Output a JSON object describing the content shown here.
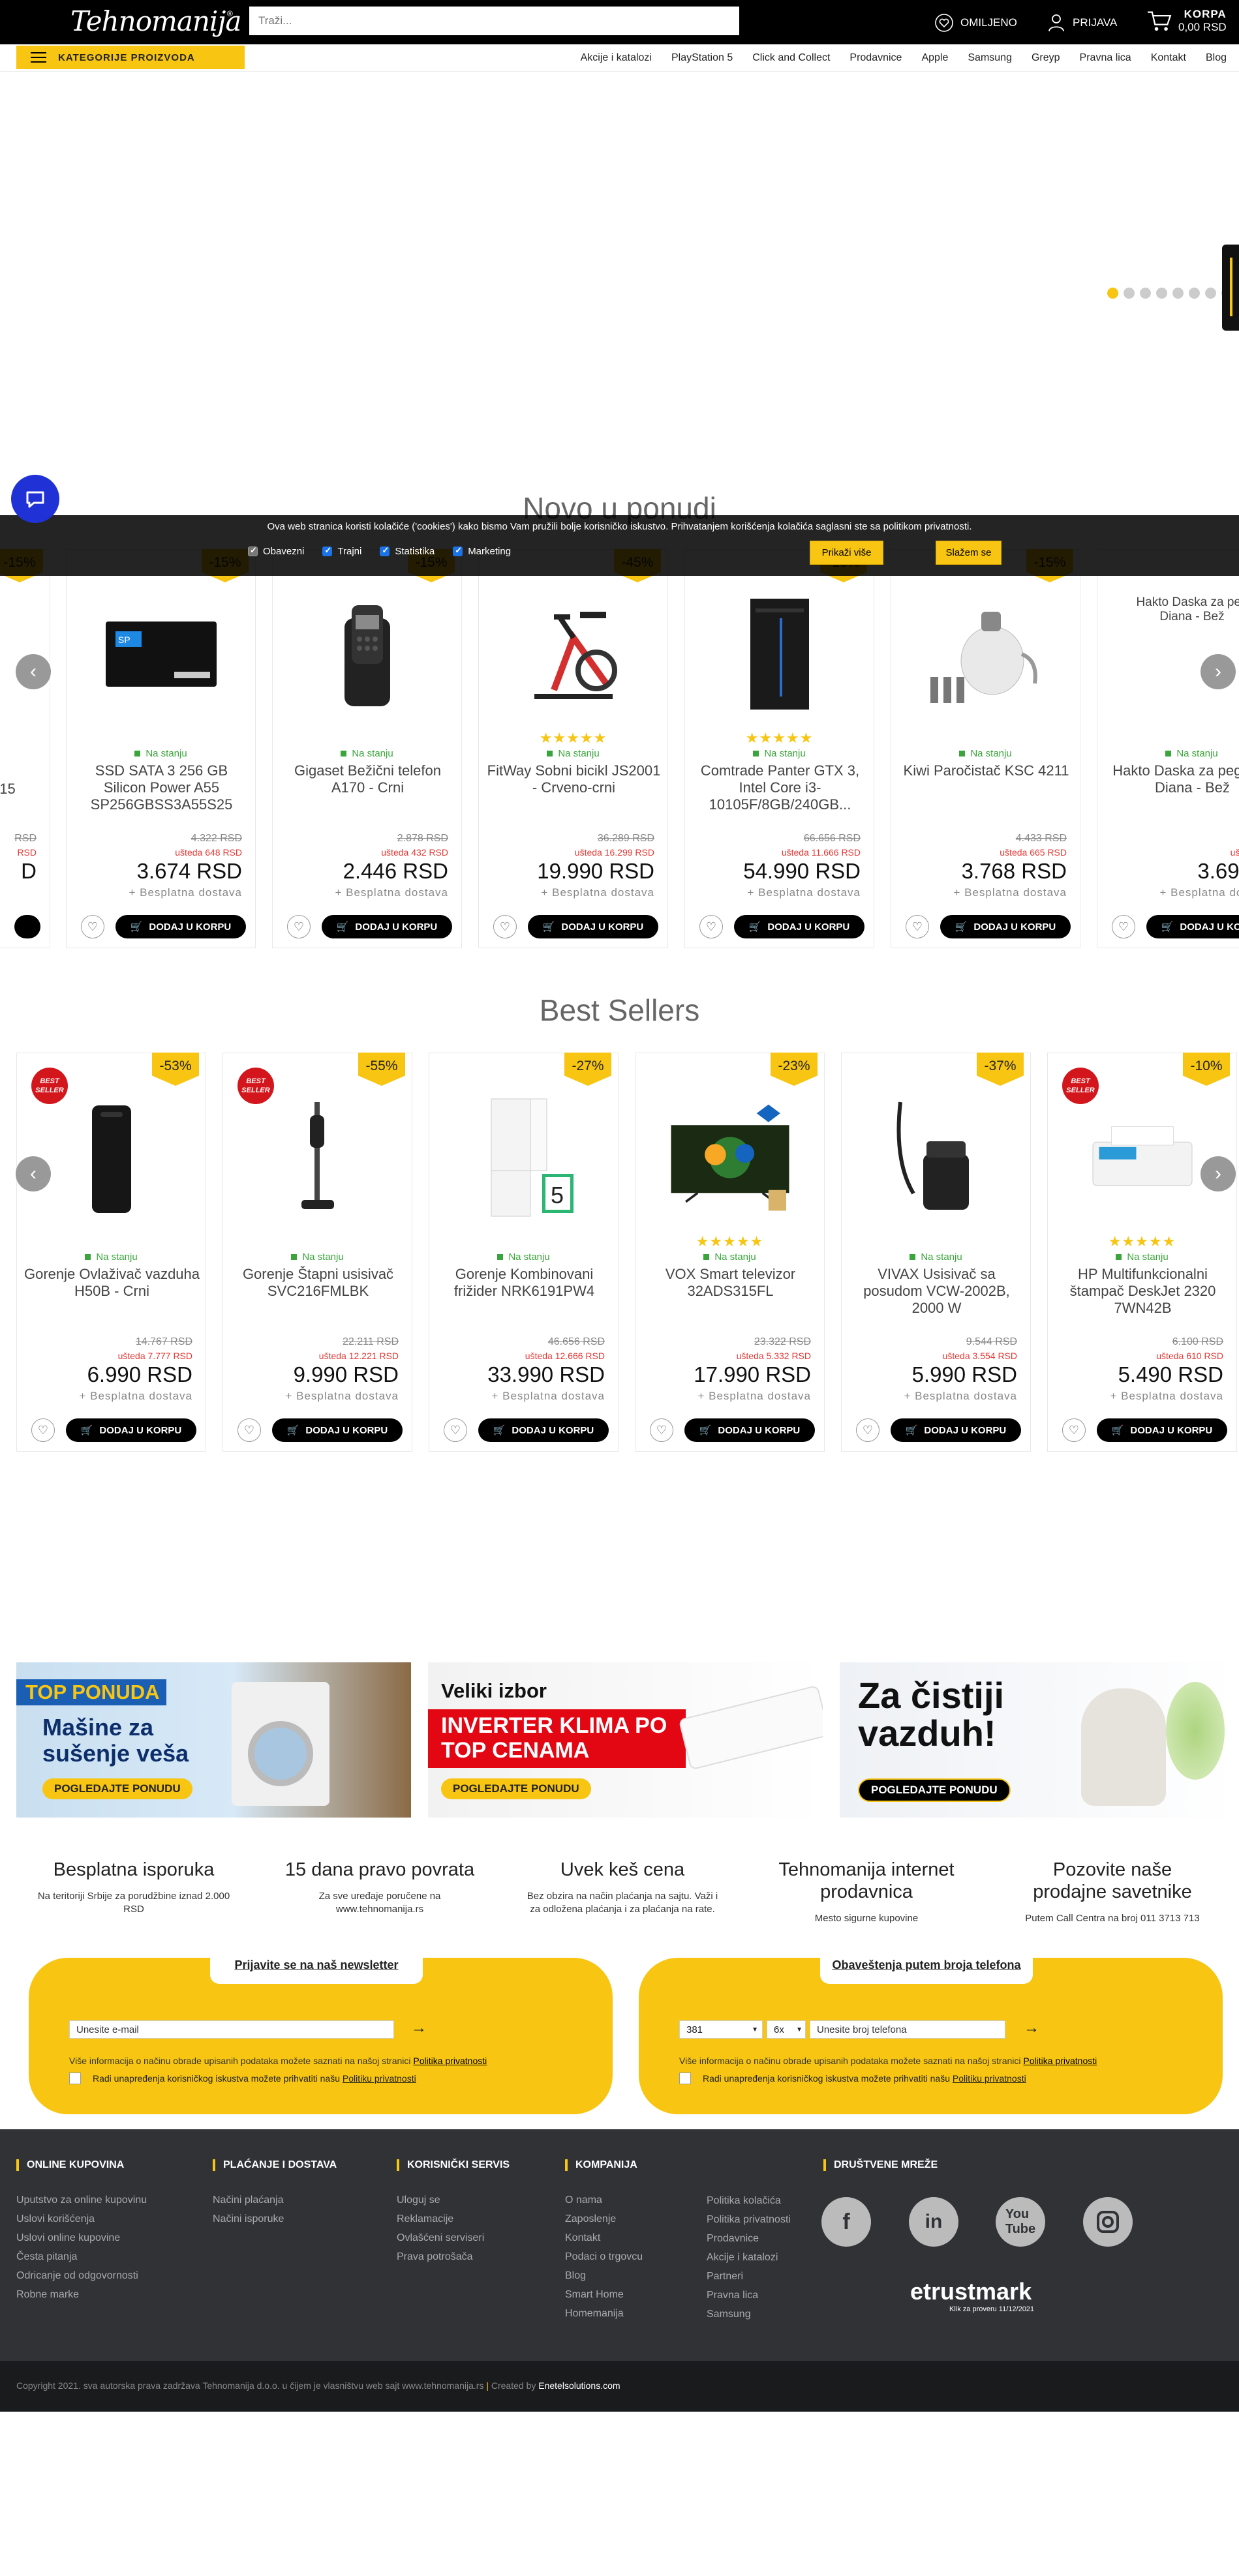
{
  "header": {
    "logo": "Tehnomanija",
    "logo_reg": "®",
    "search_placeholder": "Traži...",
    "favorites": "OMILJENO",
    "login": "PRIJAVA",
    "cart_label": "KORPA",
    "cart_total": "0,00 RSD"
  },
  "nav": {
    "categories": "KATEGORIJE PROIZVODA",
    "links": [
      "Akcije i katalozi",
      "PlayStation 5",
      "Click and Collect",
      "Prodavnice",
      "Apple",
      "Samsung",
      "Greyp",
      "Pravna lica",
      "Kontakt",
      "Blog"
    ]
  },
  "hero": {
    "dots": 8,
    "active_dot": 0
  },
  "cookie": {
    "text": "Ova web stranica koristi kolačiće ('cookies') kako bismo Vam pružili bolje korisničko iskustvo. Prihvatanjem korišćenja kolačića saglasni ste sa politikom privatnosti.",
    "options": [
      "Obavezni",
      "Trajni",
      "Statistika",
      "Marketing"
    ],
    "more": "Prikaži više",
    "agree": "Slažem se"
  },
  "new_section": {
    "title": "Novo u ponudi",
    "partial_left": {
      "name": "215",
      "price": "D",
      "old": "RSD",
      "save": "RSD"
    },
    "products": [
      {
        "name": "SSD SATA 3 256 GB Silicon Power A55 SP256GBSS3A55S25",
        "discount": "-15%",
        "stock": "Na stanju",
        "stars": false,
        "old": "4.322 RSD",
        "save": "ušteda 648 RSD",
        "price": "3.674 RSD",
        "ship": "+ Besplatna dostava",
        "img": "ssd"
      },
      {
        "name": "Gigaset Bežični telefon A170 - Crni",
        "discount": "-15%",
        "stock": "Na stanju",
        "stars": false,
        "old": "2.878 RSD",
        "save": "ušteda 432 RSD",
        "price": "2.446 RSD",
        "ship": "+ Besplatna dostava",
        "img": "phone"
      },
      {
        "name": "FitWay Sobni bicikl JS2001 - Crveno-crni",
        "discount": "-45%",
        "stock": "Na stanju",
        "stars": true,
        "old": "36.289 RSD",
        "save": "ušteda 16.299 RSD",
        "price": "19.990 RSD",
        "ship": "+ Besplatna dostava",
        "img": "bike"
      },
      {
        "name": "Comtrade Panter GTX 3, Intel Core i3-10105F/8GB/240GB...",
        "discount": "-18%",
        "stock": "Na stanju",
        "stars": true,
        "old": "66.656 RSD",
        "save": "ušteda 11.666 RSD",
        "price": "54.990 RSD",
        "ship": "+ Besplatna dostava",
        "img": "pc"
      },
      {
        "name": "Kiwi Paročistač KSC 4211",
        "discount": "-15%",
        "stock": "Na stanju",
        "stars": false,
        "old": "4.433 RSD",
        "save": "ušteda 665 RSD",
        "price": "3.768 RSD",
        "ship": "+ Besplatna dostava",
        "img": "steam"
      },
      {
        "name": "Hakto Daska za peglanje Diana - Bež",
        "discount": "",
        "stock": "Na stanju",
        "stars": false,
        "old": "5.54",
        "save": "ušteda 1.8",
        "price": "3.690 R",
        "ship": "+ Besplatna dostava",
        "img": "broken",
        "alt": "Hakto Daska za peg Diana - Bež"
      }
    ]
  },
  "best_section": {
    "title": "Best Sellers",
    "best_label": "BEST SELLER",
    "products": [
      {
        "name": "Gorenje Ovlaživač vazduha H50B - Crni",
        "discount": "-53%",
        "best": true,
        "stars": false,
        "stock": "Na stanju",
        "old": "14.767 RSD",
        "save": "ušteda 7.777 RSD",
        "price": "6.990 RSD",
        "ship": "+ Besplatna dostava",
        "img": "humid"
      },
      {
        "name": "Gorenje Štapni usisivač SVC216FMLBK",
        "discount": "-55%",
        "best": true,
        "stars": false,
        "stock": "Na stanju",
        "old": "22.211 RSD",
        "save": "ušteda 12.221 RSD",
        "price": "9.990 RSD",
        "ship": "+ Besplatna dostava",
        "img": "stick"
      },
      {
        "name": "Gorenje Kombinovani frižider NRK6191PW4",
        "discount": "-27%",
        "best": false,
        "stars": false,
        "stock": "Na stanju",
        "old": "46.656 RSD",
        "save": "ušteda 12.666 RSD",
        "price": "33.990 RSD",
        "ship": "+ Besplatna dostava",
        "img": "fridge",
        "warranty": "5"
      },
      {
        "name": "VOX Smart televizor 32ADS315FL",
        "discount": "-23%",
        "best": false,
        "stars": true,
        "stock": "Na stanju",
        "old": "23.322 RSD",
        "save": "ušteda 5.332 RSD",
        "price": "17.990 RSD",
        "ship": "+ Besplatna dostava",
        "img": "tv"
      },
      {
        "name": "VIVAX Usisivač sa posudom VCW-2002B, 2000 W",
        "discount": "-37%",
        "best": false,
        "stars": false,
        "stock": "Na stanju",
        "old": "9.544 RSD",
        "save": "ušteda 3.554 RSD",
        "price": "5.990 RSD",
        "ship": "+ Besplatna dostava",
        "img": "vacuum"
      },
      {
        "name": "HP Multifunkcionalni štampač DeskJet 2320 7WN42B",
        "discount": "-10%",
        "best": true,
        "stars": true,
        "stock": "Na stanju",
        "old": "6.100 RSD",
        "save": "ušteda 610 RSD",
        "price": "5.490 RSD",
        "ship": "+ Besplatna dostava",
        "img": "printer"
      }
    ],
    "add_label": "DODAJ U KORPU"
  },
  "banners": [
    {
      "tag": "TOP PONUDA",
      "title": "Mašine za sušenje veša",
      "cta": "POGLEDAJTE PONUDU"
    },
    {
      "tag": "Veliki izbor",
      "title": "INVERTER KLIMA PO TOP CENAMA",
      "cta": "POGLEDAJTE PONUDU"
    },
    {
      "tag": "",
      "title": "Za čistiji vazduh!",
      "cta": "POGLEDAJTE PONUDU"
    }
  ],
  "features": [
    {
      "title": "Besplatna isporuka",
      "text": "Na teritoriji Srbije za porudžbine iznad 2.000 RSD"
    },
    {
      "title": "15 dana pravo povrata",
      "text": "Za sve uređaje poručene na www.tehnomanija.rs"
    },
    {
      "title": "Uvek keš cena",
      "text": "Bez obzira na način plaćanja na sajtu. Važi i za odložena plaćanja i za plaćanja na rate."
    },
    {
      "title": "Tehnomanija internet prodavnica",
      "text": "Mesto sigurne kupovine"
    },
    {
      "title": "Pozovite naše prodajne savetnike",
      "text": "Putem Call Centra na broj 011 3713 713"
    }
  ],
  "newsletter": {
    "email_title": "Prijavite se na naš newsletter",
    "email_placeholder": "Unesite e-mail",
    "phone_title": "Obaveštenja putem broja telefona",
    "prefix": "381",
    "operator": "6x",
    "phone_placeholder": "Unesite broj telefona",
    "note": "Više informacija o načinu obrade upisanih podataka možete saznati na našoj stranici",
    "note_link": "Politika privatnosti",
    "consent": "Radi unapređenja korisničkog iskustva možete prihvatiti našu",
    "consent_link": "Politiku privatnosti"
  },
  "footer": {
    "cols": [
      {
        "title": "ONLINE KUPOVINA",
        "items": [
          "Uputstvo za online kupovinu",
          "Uslovi korišćenja",
          "Uslovi online kupovine",
          "Česta pitanja",
          "Odricanje od odgovornosti",
          "Robne marke"
        ]
      },
      {
        "title": "PLAĆANJE I DOSTAVA",
        "items": [
          "Načini plaćanja",
          "Načini isporuke"
        ]
      },
      {
        "title": "KORISNIČKI SERVIS",
        "items": [
          "Uloguj se",
          "Reklamacije",
          "Ovlašćeni serviseri",
          "Prava potrošača"
        ]
      },
      {
        "title": "KOMPANIJA",
        "items": [
          "O nama",
          "Zaposlenje",
          "Kontakt",
          "Podaci o trgovcu",
          "Blog",
          "Smart Home",
          "Homemanija"
        ]
      },
      {
        "title": "",
        "items": [
          "Politika kolačića",
          "Politika privatnosti",
          "Prodavnice",
          "Akcije i katalozi",
          "Partneri",
          "Pravna lica",
          "Samsung"
        ]
      }
    ],
    "social_title": "DRUŠTVENE MREŽE",
    "trustmark": "trustmark",
    "trust_note": "Klik za proveru 11/12/2021",
    "copyright": "Copyright 2021. sva autorska prava zadržava Tehnomanija d.o.o. u čijem je vlasništvu web sajt www.tehnomanija.rs",
    "created_by": "Created by",
    "agency": "Enetelsolutions.com"
  },
  "colors": {
    "accent": "#f7c512",
    "dark": "#000000",
    "footer": "#303236",
    "stock": "#3aa53a",
    "save": "#e53935",
    "badge_red": "#d3161c"
  }
}
